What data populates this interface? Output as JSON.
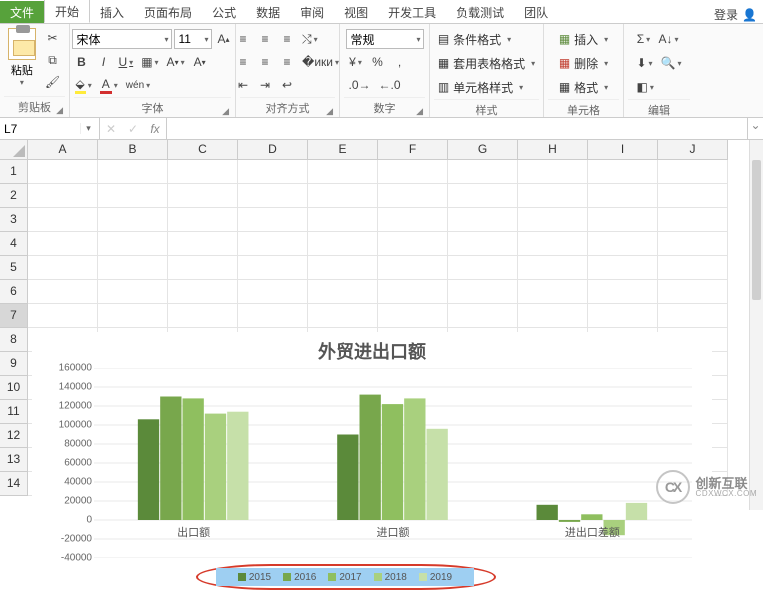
{
  "tabs": {
    "file": "文件",
    "items": [
      "开始",
      "插入",
      "页面布局",
      "公式",
      "数据",
      "审阅",
      "视图",
      "开发工具",
      "负载测试",
      "团队"
    ],
    "active_index": 0,
    "login": "登录"
  },
  "ribbon": {
    "clipboard": {
      "paste": "粘贴",
      "label": "剪贴板"
    },
    "font": {
      "name": "宋体",
      "size": "11",
      "label": "字体",
      "bold": "B",
      "italic": "I",
      "underline": "U"
    },
    "align": {
      "label": "对齐方式"
    },
    "number": {
      "format": "常规",
      "label": "数字"
    },
    "styles": {
      "cond": "条件格式",
      "table": "套用表格格式",
      "cell": "单元格样式",
      "label": "样式"
    },
    "cells_grp": {
      "insert": "插入",
      "delete": "删除",
      "format": "格式",
      "label": "单元格"
    },
    "editing": {
      "label": "编辑"
    }
  },
  "fx": {
    "namebox": "L7",
    "fx_label": "fx"
  },
  "grid": {
    "cols": [
      "A",
      "B",
      "C",
      "D",
      "E",
      "F",
      "G",
      "H",
      "I",
      "J"
    ],
    "rows": [
      "1",
      "2",
      "3",
      "4",
      "5",
      "6",
      "7",
      "8",
      "9",
      "10",
      "11",
      "12",
      "13",
      "14"
    ],
    "selected_row": "7"
  },
  "watermark": {
    "cn": "创新互联",
    "py": "CDXWCX.COM"
  },
  "chart_data": {
    "type": "bar",
    "title": "外贸进出口额",
    "categories": [
      "出口额",
      "进口额",
      "进出口差额"
    ],
    "series": [
      {
        "name": "2015",
        "color": "#5b8a3a",
        "values": [
          106000,
          90000,
          16000
        ]
      },
      {
        "name": "2016",
        "color": "#78a74c",
        "values": [
          130000,
          132000,
          -2000
        ]
      },
      {
        "name": "2017",
        "color": "#8fbf5f",
        "values": [
          128000,
          122000,
          6000
        ]
      },
      {
        "name": "2018",
        "color": "#a9d07e",
        "values": [
          112000,
          128000,
          -16000
        ]
      },
      {
        "name": "2019",
        "color": "#c6e0a9",
        "values": [
          114000,
          96000,
          18000
        ]
      }
    ],
    "y_ticks": [
      -40000,
      -20000,
      0,
      20000,
      40000,
      60000,
      80000,
      100000,
      120000,
      140000,
      160000
    ],
    "ylim": [
      -40000,
      160000
    ],
    "xlabel": "",
    "ylabel": ""
  }
}
